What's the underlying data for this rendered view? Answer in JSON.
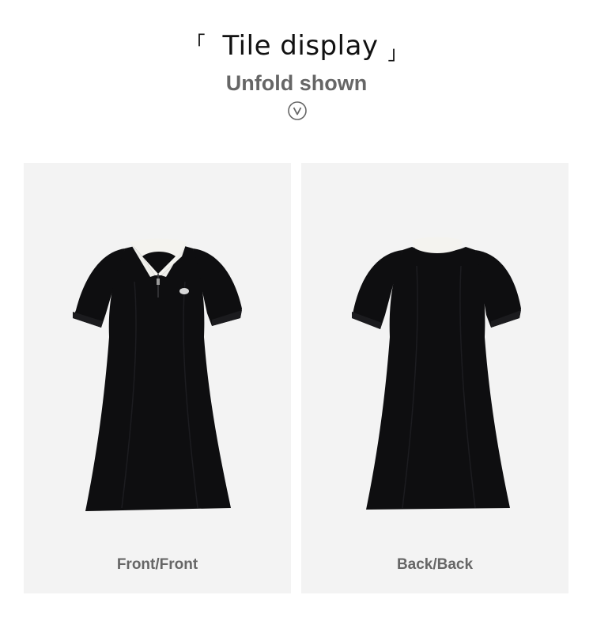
{
  "header": {
    "bracket_open": "「",
    "title": "Tile display",
    "bracket_close": "」",
    "subtitle": "Unfold shown",
    "indicator_icon": "chevron-down-circle-icon"
  },
  "panels": [
    {
      "label": "Front/Front",
      "view": "front"
    },
    {
      "label": "Back/Back",
      "view": "back"
    }
  ],
  "colors": {
    "background": "#ffffff",
    "panel": "#f3f3f3",
    "dress": "#0e0e10",
    "collar": "#f4f3ef",
    "label": "#666666"
  }
}
